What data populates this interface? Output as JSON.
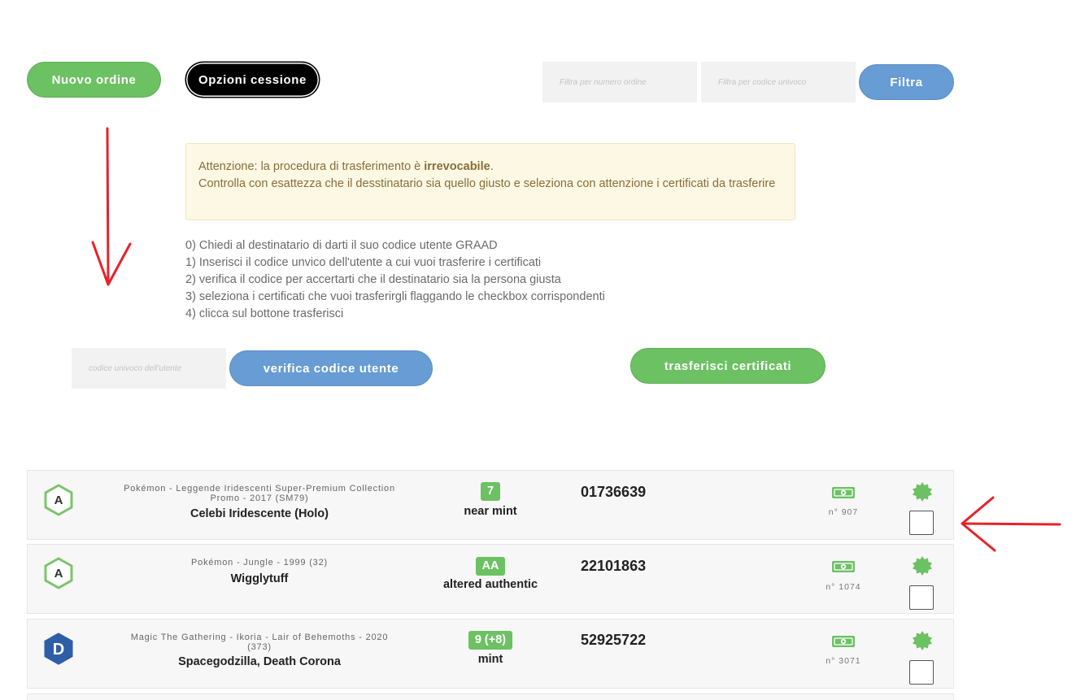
{
  "toolbar": {
    "new_order_label": "Nuovo ordine",
    "transfer_options_label": "Opzioni cessione",
    "filter_order_placeholder": "Filtra per numero ordine",
    "filter_code_placeholder": "Filtra per codice univoco",
    "filter_label": "Filtra"
  },
  "alert": {
    "line1_prefix": "Attenzione: la procedura di trasferimento è ",
    "line1_bold": "irrevocabile",
    "line1_suffix": ".",
    "line2": "Controlla con esattezza che il desstinatario sia quello giusto e seleziona con attenzione i certificati da trasferire"
  },
  "steps": [
    "0) Chiedi al destinatario di darti il suo codice utente GRAAD",
    "1) Inserisci il codice unvico dell'utente a cui vuoi trasferire i certificati",
    "2) verifica il codice per accertarti che il destinatario sia la persona giusta",
    "3) seleziona i certificati che vuoi trasferirgli flaggando le checkbox corrispondenti",
    "4) clicca sul bottone trasferisci"
  ],
  "transfer": {
    "user_code_placeholder": "codice univoco dell'utente",
    "verify_label": "verifica codice utente",
    "transfer_label": "trasferisci certificati"
  },
  "certificates": [
    {
      "badge": "A",
      "badge_color": "#7dc36d",
      "meta_line1": "Pokémon - Leggende Iridescenti Super-Premium Collection",
      "meta_line2": "Promo - 2017 (SM79)",
      "name": "Celebi Iridescente (Holo)",
      "grade": "7",
      "grade_label": "near mint",
      "code": "01736639",
      "order": "n° 907",
      "money_icon": "banknote-icon",
      "seal_icon": "seal-icon"
    },
    {
      "badge": "A",
      "badge_color": "#7dc36d",
      "meta_line1": "Pokémon - Jungle - 1999 (32)",
      "meta_line2": "",
      "name": "Wigglytuff",
      "grade": "AA",
      "grade_label": "altered authentic",
      "code": "22101863",
      "order": "n° 1074",
      "money_icon": "banknote-icon",
      "seal_icon": "seal-icon"
    },
    {
      "badge": "D",
      "badge_color": "#2e5ea6",
      "meta_line1": "Magic The Gathering - Ikoria - Lair of Behemoths - 2020",
      "meta_line2": "(373)",
      "name": "Spacegodzilla, Death Corona",
      "grade": "9 (+8)",
      "grade_label": "mint",
      "code": "52925722",
      "order": "n° 3071",
      "money_icon": "banknote-icon",
      "seal_icon": "seal-icon"
    }
  ],
  "colors": {
    "green": "#6cc163",
    "blue": "#679cd4",
    "annotation_red": "#e8212a"
  }
}
